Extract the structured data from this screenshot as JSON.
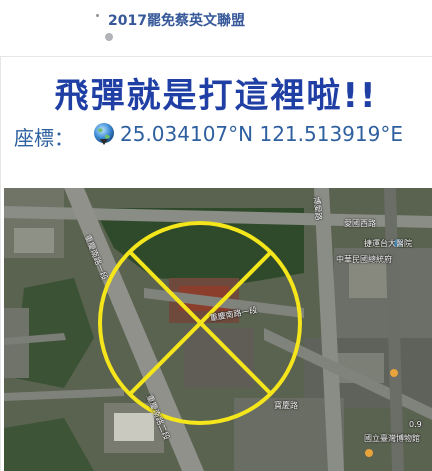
{
  "post": {
    "group_name": "2017罷免蔡英文聯盟"
  },
  "image": {
    "headline": "飛彈就是打這裡啦!!",
    "coords_label": "座標：",
    "coords_value": "25.034107°N 121.513919°E",
    "map_labels": {
      "aiguo_rd": "愛國西路",
      "chongqing_s_rd_1": "重慶南路一段",
      "chongqing_s_rd_2": "重慶南路二段",
      "chongqing_s_rd_3": "重慶南路一段",
      "boai_rd": "博愛路",
      "poi_1": "捷運台大醫院",
      "poi_2": "中華民國總統府",
      "poi_3": "國立臺灣博物館",
      "road_small": "寶慶路",
      "scale": "0.9"
    },
    "colors": {
      "headline": "#1f3fa5",
      "coords": "#2e5f9e",
      "target_circle": "#f5e61c",
      "group_link": "#365899"
    },
    "icons": {
      "globe": "globe-icon",
      "privacy": "globe-privacy-icon"
    }
  }
}
